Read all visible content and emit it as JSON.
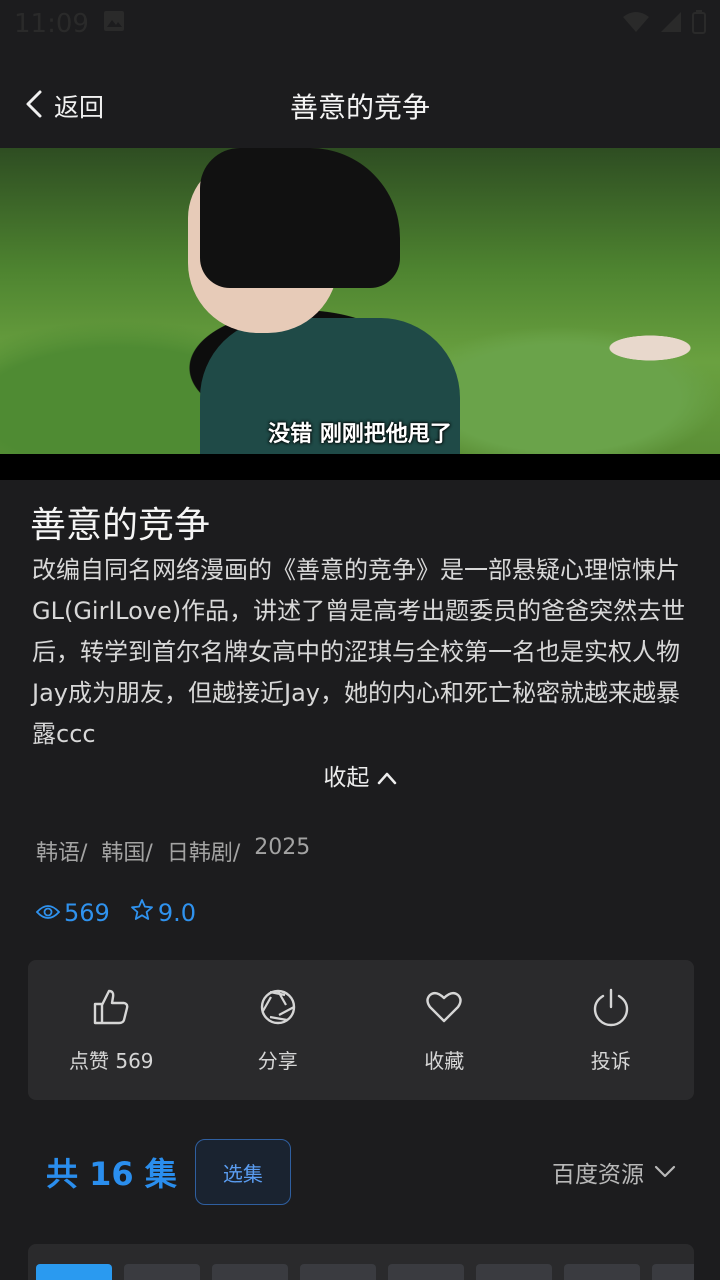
{
  "status_bar": {
    "time": "11:09"
  },
  "nav": {
    "back_label": "返回",
    "title": "善意的竞争"
  },
  "video": {
    "subtitle": "没错 刚刚把他甩了"
  },
  "show": {
    "title": "善意的竞争",
    "description": "改编自同名网络漫画的《善意的竞争》是一部悬疑心理惊悚片GL(GirlLove)作品，讲述了曾是高考出题委员的爸爸突然去世后，转学到首尔名牌女高中的涩琪与全校第一名也是实权人物Jay成为朋友，但越接近Jay，她的内心和死亡秘密就越来越暴露ccc",
    "collapse_label": "收起",
    "tags": [
      "韩语/",
      "韩国/",
      "日韩剧/",
      "2025"
    ],
    "views": "569",
    "rating": "9.0"
  },
  "actions": {
    "like": "点赞 569",
    "share": "分享",
    "favorite": "收藏",
    "report": "投诉"
  },
  "episodes": {
    "count_label": "共 16 集",
    "select_label": "选集",
    "source_label": "百度资源"
  },
  "colors": {
    "accent": "#2a8eee",
    "background": "#1c1c1e",
    "panel": "#2a2a2c"
  }
}
